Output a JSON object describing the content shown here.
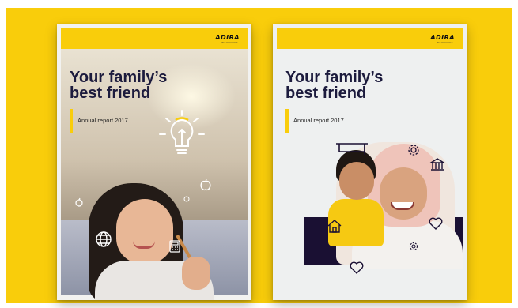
{
  "covers": [
    {
      "logo": "ADIRA",
      "logo_sub": "INSURANCE",
      "title_line1": "Your family’s",
      "title_line2": "best friend",
      "subtitle": "Annual report 2017"
    },
    {
      "logo": "ADIRA",
      "logo_sub": "INSURANCE",
      "title_line1": "Your family’s",
      "title_line2": "best friend",
      "subtitle": "Annual report 2017"
    }
  ],
  "colors": {
    "brand_yellow": "#f9cd0b",
    "title_navy": "#1c1b3d",
    "dark_block": "#1a1033"
  },
  "icons": {
    "left": [
      "lightbulb-icon",
      "apple-icon",
      "globe-icon",
      "calculator-icon",
      "small-apple-icon",
      "small-dot-icon"
    ],
    "right": [
      "graduation-cap-icon",
      "gear-icon",
      "bank-icon",
      "house-icon",
      "heart-icon",
      "small-gear-icon"
    ]
  }
}
